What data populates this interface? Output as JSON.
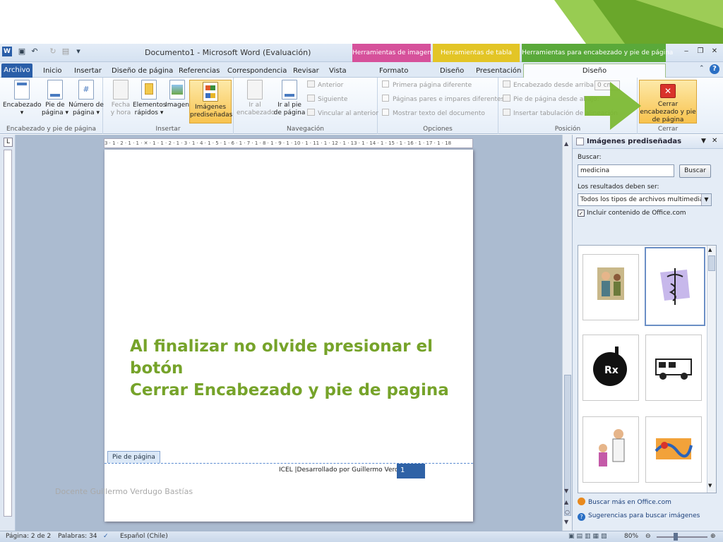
{
  "window": {
    "title": "Documento1 - Microsoft Word (Evaluación)",
    "contextual_tabs": [
      {
        "label": "Herramientas de imagen",
        "color": "#d84f9a"
      },
      {
        "label": "Herramientas de tabla",
        "color": "#e8c928"
      },
      {
        "label": "Herramientas para encabezado y pie de página",
        "color": "#5fae3a"
      }
    ]
  },
  "tabs": [
    "Archivo",
    "Inicio",
    "Insertar",
    "Diseño de página",
    "Referencias",
    "Correspondencia",
    "Revisar",
    "Vista",
    "Formato",
    "Diseño",
    "Presentación",
    "Diseño"
  ],
  "ribbon": {
    "groups": {
      "encabezado": "Encabezado y pie de página",
      "insertar": "Insertar",
      "navegacion": "Navegación",
      "opciones": "Opciones",
      "posicion": "Posición",
      "cerrar": "Cerrar"
    },
    "buttons": {
      "encabezado": "Encabezado",
      "pie": "Pie de página",
      "numero": "Número de página",
      "fecha": "Fecha y hora",
      "elementos": "Elementos rápidos",
      "imagen": "Imagen",
      "imagenes_pred": "Imágenes prediseñadas",
      "ir_enc": "Ir al encabezado",
      "ir_pie": "Ir al pie de página",
      "anterior": "Anterior",
      "siguiente": "Siguiente",
      "vincular": "Vincular al anterior",
      "primera": "Primera página diferente",
      "pares": "Páginas pares e impares diferentes",
      "mostrar": "Mostrar texto del documento",
      "enc_desde": "Encabezado desde arriba:",
      "enc_valor": "0 cm",
      "pie_desde": "Pie de página desde abajo:",
      "insertar_tab": "Insertar tabulación de alineación",
      "cerrar": "Cerrar encabezado y pie de página"
    }
  },
  "ruler_text": "3 · 1 · 2 · 1 · 1 · ✕ · 1 · 1 · 2 · 1 · 3 · 1 · 4 · 1 · 5 · 1 · 6 · 1 · 7 · 1 · 8 · 1 · 9 · 1 · 10 · 1 · 11 · 1 · 12 · 1 · 13 · 1 · 14 · 1 · 15 · 1 · 16 · 1 · 17 · 1 · 18",
  "document": {
    "instruction_line1": "Al finalizar no olvide presionar el botón",
    "instruction_line2": "Cerrar Encabezado y pie de pagina",
    "footer_tab": "Pie de página",
    "footer_text": "ICEL  |Desarrollado por Guillermo Verdugo",
    "footer_page": "1",
    "slide_footer": "Docente Guillermo Verdugo Bastías"
  },
  "clipart_pane": {
    "title": "Imágenes prediseñadas",
    "search_label": "Buscar:",
    "search_value": "medicina",
    "search_button": "Buscar",
    "results_label": "Los resultados deben ser:",
    "results_value": "Todos los tipos de archivos multimedia",
    "include_label": "Incluir contenido de Office.com",
    "include_checked": true,
    "more_link": "Buscar más en Office.com",
    "tips_link": "Sugerencias para buscar imágenes",
    "thumbnails": [
      "doctor-with-patient-clipart",
      "caduceus-clipart",
      "rx-mortar-clipart",
      "ambulance-clipart",
      "doctor-and-child-clipart",
      "abstract-medical-clipart"
    ]
  },
  "status": {
    "page": "Página: 2 de 2",
    "words": "Palabras: 34",
    "language": "Español (Chile)",
    "zoom": "80%"
  },
  "colors": {
    "accent_green": "#76a32a",
    "arrow_green": "#7ab72e",
    "word_blue": "#2a5ea8",
    "page_number_bg": "#2f62a6"
  }
}
